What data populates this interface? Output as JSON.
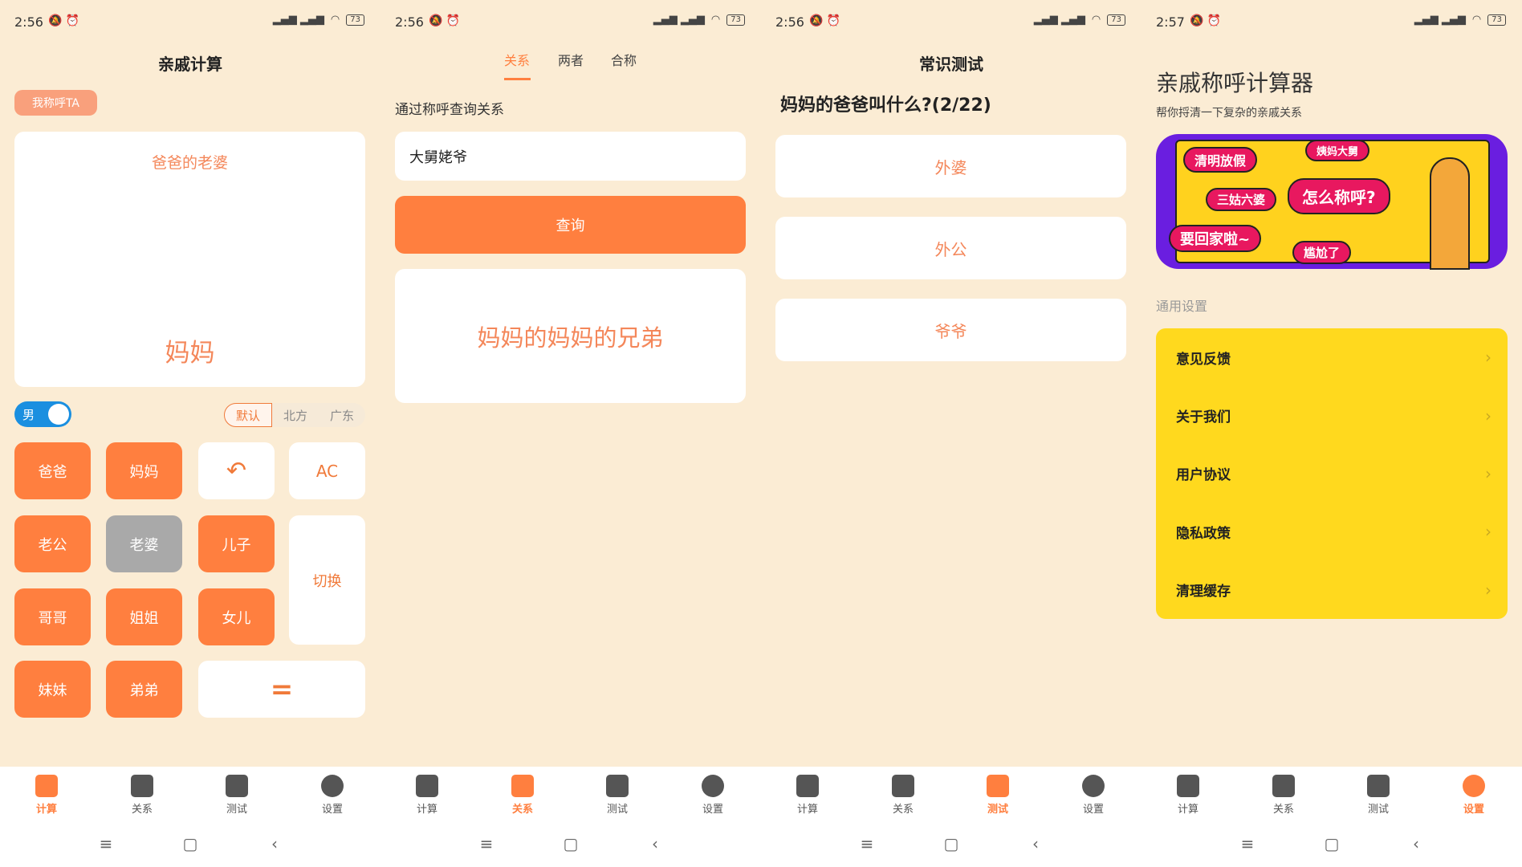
{
  "colors": {
    "accent": "#ff7f3f",
    "background": "#fbecd4",
    "toggle": "#1a8fe0",
    "settings_card": "#ffd91e",
    "banner_frame": "#6a1ee0"
  },
  "status_times": [
    "2:56",
    "2:56",
    "2:56",
    "2:57"
  ],
  "battery": "73",
  "nav": {
    "tabs": [
      {
        "label": "计算",
        "icon": "house-icon"
      },
      {
        "label": "关系",
        "icon": "people-icon"
      },
      {
        "label": "测试",
        "icon": "checklist-icon"
      },
      {
        "label": "设置",
        "icon": "hexagon-nut-icon"
      }
    ],
    "active": [
      0,
      1,
      2,
      3
    ]
  },
  "calc": {
    "title": "亲戚计算",
    "mode_button": "我称呼TA",
    "expression": "爸爸的老婆",
    "result": "妈妈",
    "gender_toggle": "男",
    "gender_on": true,
    "dialects": [
      "默认",
      "北方",
      "广东"
    ],
    "dialect_selected": "默认",
    "keys": {
      "baba": "爸爸",
      "mama": "妈妈",
      "undo": "↶",
      "ac": "AC",
      "laogong": "老公",
      "laopo": "老婆",
      "erzi": "儿子",
      "switch": "切换",
      "gege": "哥哥",
      "jiejie": "姐姐",
      "nver": "女儿",
      "meimei": "妹妹",
      "didi": "弟弟",
      "equals": "="
    }
  },
  "relation": {
    "tabs": [
      "关系",
      "两者",
      "合称"
    ],
    "active_tab": "关系",
    "label": "通过称呼查询关系",
    "input_value": "大舅姥爷",
    "query_button": "查询",
    "result": "妈妈的妈妈的兄弟"
  },
  "quiz": {
    "title": "常识测试",
    "question": "妈妈的爸爸叫什么?(2/22)",
    "options": [
      "外婆",
      "外公",
      "爷爷"
    ]
  },
  "settings": {
    "title": "亲戚称呼计算器",
    "subtitle": "帮你捋清一下复杂的亲戚关系",
    "banner": {
      "bubbles": [
        "清明放假",
        "姨妈大舅",
        "三姑六婆",
        "怎么称呼?",
        "要回家啦~",
        "尴尬了"
      ]
    },
    "section": "通用设置",
    "items": [
      "意见反馈",
      "关于我们",
      "用户协议",
      "隐私政策",
      "清理缓存"
    ]
  }
}
